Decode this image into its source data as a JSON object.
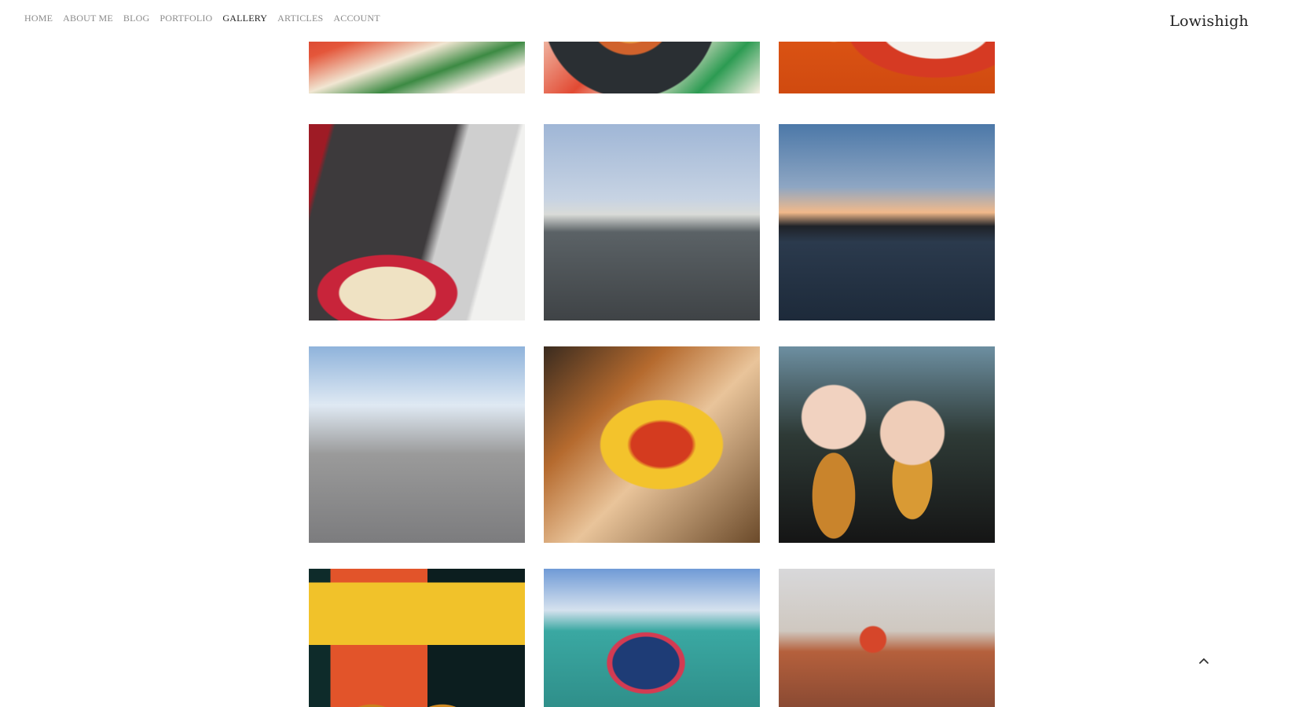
{
  "nav": {
    "items": [
      {
        "label": "HOME",
        "active": false
      },
      {
        "label": "ABOUT ME",
        "active": false
      },
      {
        "label": "BLOG",
        "active": false
      },
      {
        "label": "PORTFOLIO",
        "active": false
      },
      {
        "label": "GALLERY",
        "active": true
      },
      {
        "label": "ARTICLES",
        "active": false
      },
      {
        "label": "ACCOUNT",
        "active": false
      }
    ]
  },
  "site": {
    "title": "Lowishigh"
  },
  "colors": {
    "nav_text": "#8a8a8a",
    "nav_active": "#222222",
    "background": "#ffffff"
  },
  "gallery": {
    "photos": [
      {
        "name": "photo-wrap-held-in-hand"
      },
      {
        "name": "photo-tacos-on-plate"
      },
      {
        "name": "photo-soup-and-drink"
      },
      {
        "name": "photo-currywurst-stand"
      },
      {
        "name": "photo-winter-road-trees"
      },
      {
        "name": "photo-river-sunset-skyline"
      },
      {
        "name": "photo-woman-red-hat-street"
      },
      {
        "name": "photo-nachos-tray"
      },
      {
        "name": "photo-two-friends-with-beers"
      },
      {
        "name": "photo-beers-at-bar"
      },
      {
        "name": "photo-elephant-mural-building"
      },
      {
        "name": "photo-woman-red-hat-harbor"
      }
    ]
  },
  "icons": {
    "back_to_top": "chevron-up-icon"
  }
}
